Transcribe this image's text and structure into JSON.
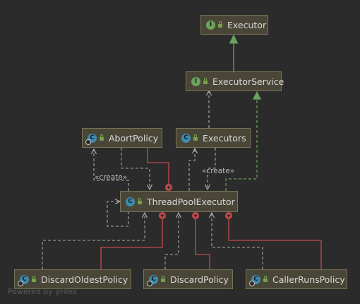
{
  "nodes": {
    "executor": {
      "name": "Executor",
      "kind": "interface",
      "kind_letter": "I"
    },
    "executor_service": {
      "name": "ExecutorService",
      "kind": "interface",
      "kind_letter": "I"
    },
    "abort_policy": {
      "name": "AbortPolicy",
      "kind": "class",
      "kind_letter": "C"
    },
    "executors": {
      "name": "Executors",
      "kind": "class",
      "kind_letter": "C"
    },
    "thread_pool_executor": {
      "name": "ThreadPoolExecutor",
      "kind": "class",
      "kind_letter": "C"
    },
    "discard_oldest_policy": {
      "name": "DiscardOldestPolicy",
      "kind": "class",
      "kind_letter": "C"
    },
    "discard_policy": {
      "name": "DiscardPolicy",
      "kind": "class",
      "kind_letter": "C"
    },
    "caller_runs_policy": {
      "name": "CallerRunsPolicy",
      "kind": "class",
      "kind_letter": "C"
    }
  },
  "edge_labels": {
    "create_left": "«create»",
    "create_right": "«create»"
  },
  "watermark": "Powered by yFiles",
  "colors": {
    "background": "#2b2b2b",
    "inheritance": "#6ba35d",
    "dependency": "#a9a9a9",
    "inner_class": "#c44b4b",
    "node_fill": "#4a4637"
  }
}
